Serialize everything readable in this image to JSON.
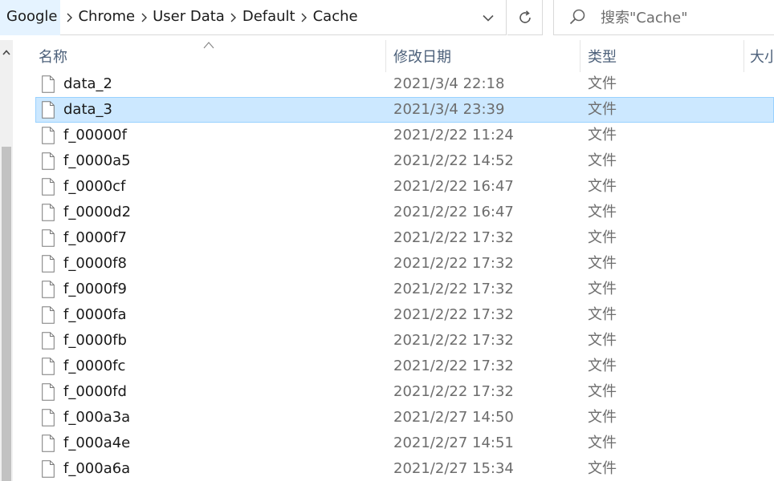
{
  "breadcrumb": {
    "items": [
      "Google",
      "Chrome",
      "User Data",
      "Default",
      "Cache"
    ]
  },
  "search": {
    "placeholder": "搜索\"Cache\""
  },
  "columns": {
    "name": "名称",
    "date": "修改日期",
    "type": "类型",
    "size": "大小"
  },
  "files": [
    {
      "name": "data_2",
      "date": "2021/3/4 22:18",
      "type": "文件",
      "selected": false
    },
    {
      "name": "data_3",
      "date": "2021/3/4 23:39",
      "type": "文件",
      "selected": true
    },
    {
      "name": "f_00000f",
      "date": "2021/2/22 11:24",
      "type": "文件",
      "selected": false
    },
    {
      "name": "f_0000a5",
      "date": "2021/2/22 14:52",
      "type": "文件",
      "selected": false
    },
    {
      "name": "f_0000cf",
      "date": "2021/2/22 16:47",
      "type": "文件",
      "selected": false
    },
    {
      "name": "f_0000d2",
      "date": "2021/2/22 16:47",
      "type": "文件",
      "selected": false
    },
    {
      "name": "f_0000f7",
      "date": "2021/2/22 17:32",
      "type": "文件",
      "selected": false
    },
    {
      "name": "f_0000f8",
      "date": "2021/2/22 17:32",
      "type": "文件",
      "selected": false
    },
    {
      "name": "f_0000f9",
      "date": "2021/2/22 17:32",
      "type": "文件",
      "selected": false
    },
    {
      "name": "f_0000fa",
      "date": "2021/2/22 17:32",
      "type": "文件",
      "selected": false
    },
    {
      "name": "f_0000fb",
      "date": "2021/2/22 17:32",
      "type": "文件",
      "selected": false
    },
    {
      "name": "f_0000fc",
      "date": "2021/2/22 17:32",
      "type": "文件",
      "selected": false
    },
    {
      "name": "f_0000fd",
      "date": "2021/2/22 17:32",
      "type": "文件",
      "selected": false
    },
    {
      "name": "f_000a3a",
      "date": "2021/2/27 14:50",
      "type": "文件",
      "selected": false
    },
    {
      "name": "f_000a4e",
      "date": "2021/2/27 14:51",
      "type": "文件",
      "selected": false
    },
    {
      "name": "f_000a6a",
      "date": "2021/2/27 15:34",
      "type": "文件",
      "selected": false
    }
  ],
  "icons": {
    "file": "file-icon",
    "breadcrumb_separator": "chevron-right-icon",
    "history": "chevron-down-icon",
    "refresh": "refresh-icon",
    "search": "search-icon",
    "sort": "sort-up-icon",
    "scroll_up": "scroll-up-icon"
  },
  "colors": {
    "selection_fill": "#cce8ff",
    "selection_border": "#99d1ff",
    "header_text": "#4c607a",
    "secondary_text": "#6d6d6d",
    "breadcrumb_highlight": "#e5f3ff"
  }
}
